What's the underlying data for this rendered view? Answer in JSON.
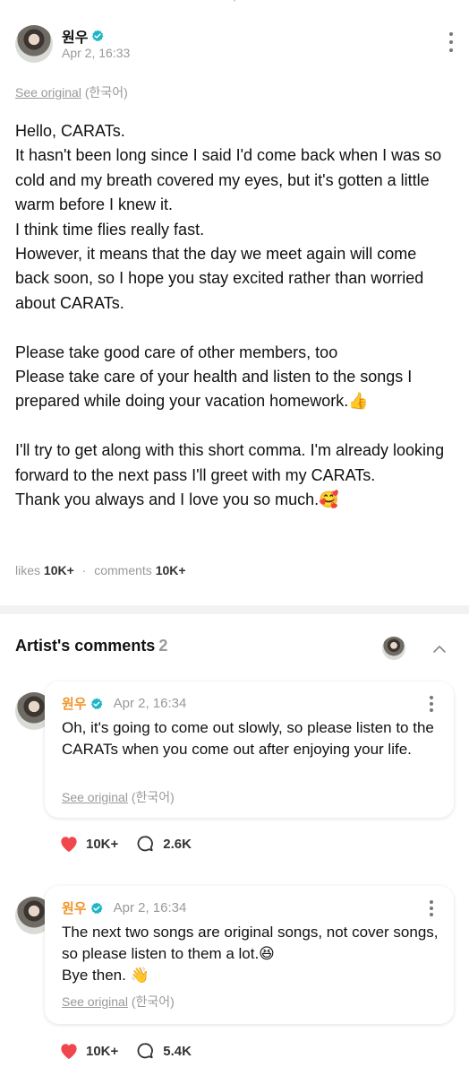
{
  "post": {
    "author": "원우",
    "date": "Apr 2, 16:33",
    "see_original": "See original",
    "original_lang": "(한국어)",
    "paragraphs": [
      "Hello, CARATs.",
      "It hasn't been long since I said I'd come back when I was so cold and my breath covered my eyes, but it's gotten a little warm before I knew it.",
      "I think time flies really fast.",
      "However, it means that the day we meet again will come back soon, so I hope you stay excited rather than worried about CARATs.",
      "",
      "Please take good care of other members, too",
      "Please take care of your health and listen to the songs I prepared while doing your vacation homework.👍",
      "",
      "I'll try to get along with this short comma. I'm already looking forward to the next pass I'll greet with my CARATs.",
      "Thank you always and I love you so much.🥰"
    ],
    "likes_label": "likes",
    "likes_count": "10K+",
    "comments_label": "comments",
    "comments_count": "10K+"
  },
  "artist_comments": {
    "title": "Artist's comments",
    "count": "2",
    "items": [
      {
        "author": "원우",
        "date": "Apr 2, 16:34",
        "text": "Oh, it's going to come out slowly, so please listen to the CARATs when you come out after enjoying your life.",
        "see_original": "See original",
        "original_lang": "(한국어)",
        "likes": "10K+",
        "replies": "2.6K"
      },
      {
        "author": "원우",
        "date": "Apr 2, 16:34",
        "text_lines": [
          "The next two songs are original songs, not cover songs, so please listen to them a lot.😆",
          "Bye then. 👋"
        ],
        "see_original": "See original",
        "original_lang": "(한국어)",
        "likes": "10K+",
        "replies": "5.4K"
      }
    ]
  },
  "colors": {
    "verified": "#1fb5c7",
    "author_orange": "#f0962c",
    "heart": "#f0474f",
    "muted": "#999999"
  },
  "icons": [
    "verified-badge-icon",
    "kebab-menu-icon",
    "chevron-up-icon",
    "heart-icon",
    "comment-bubble-icon"
  ]
}
